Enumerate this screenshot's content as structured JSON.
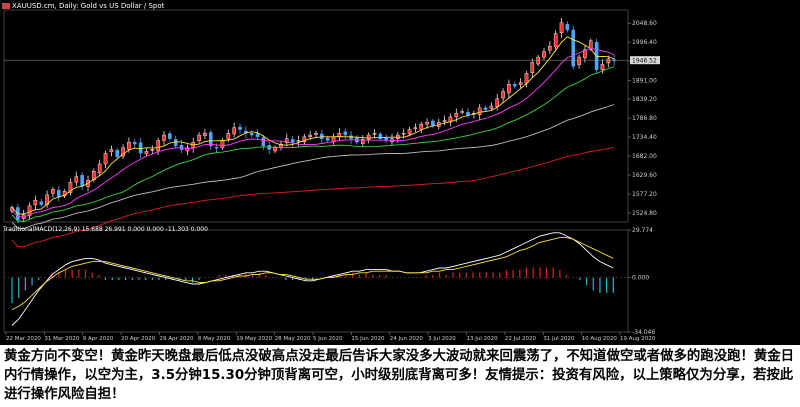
{
  "window": {
    "title": "XAUUSD.cm, Daily: Gold vs US Dollar / Spot",
    "indicator_title": "TraditionalMACD(12,26,9) 15.688 26.991 0.000 0.000 -11.303 0.000"
  },
  "chart_data": [
    {
      "type": "candlestick",
      "title": "XAUUSD.cm, Daily: Gold vs US Dollar / Spot",
      "symbol": "XAUUSD.cm",
      "timeframe": "Daily",
      "x_tick_labels": [
        "22 Mar 2020",
        "31 Mar 2020",
        "9 Apr 2020",
        "20 Apr 2020",
        "29 Apr 2020",
        "8 May 2020",
        "19 May 2020",
        "28 May 2020",
        "5 Jun 2020",
        "15 Jun 2020",
        "24 Jun 2020",
        "3 Jul 2020",
        "13 Jul 2020",
        "22 Jul 2020",
        "31 Jul 2020",
        "10 Aug 2020",
        "19 Aug 2020"
      ],
      "y_tick_labels": [
        "2048.60",
        "1996.40",
        "1944.20",
        "1891.00",
        "1839.20",
        "1786.80",
        "1734.40",
        "1682.00",
        "1629.60",
        "1577.20",
        "1524.80"
      ],
      "ylim": [
        1500,
        2085
      ],
      "current_price": "1946.52",
      "colors": {
        "up": "#ffffff",
        "down": "#4ea6ff",
        "up_body": "#ff2a2a",
        "ma1": "#ffe23a",
        "ma2": "#ff3cff",
        "ma3": "#38d838",
        "ma4": "#bcbcbc",
        "ma5": "#e02020"
      },
      "close": [
        1540,
        1505,
        1520,
        1545,
        1560,
        1548,
        1575,
        1590,
        1570,
        1585,
        1610,
        1625,
        1600,
        1615,
        1640,
        1660,
        1690,
        1700,
        1680,
        1705,
        1720,
        1715,
        1690,
        1695,
        1700,
        1725,
        1740,
        1730,
        1710,
        1700,
        1705,
        1720,
        1740,
        1745,
        1710,
        1705,
        1725,
        1745,
        1760,
        1755,
        1745,
        1740,
        1735,
        1710,
        1700,
        1705,
        1715,
        1730,
        1720,
        1725,
        1735,
        1740,
        1745,
        1730,
        1725,
        1735,
        1745,
        1740,
        1730,
        1720,
        1728,
        1740,
        1745,
        1730,
        1725,
        1730,
        1740,
        1745,
        1755,
        1760,
        1770,
        1775,
        1765,
        1775,
        1780,
        1790,
        1800,
        1805,
        1795,
        1800,
        1815,
        1810,
        1820,
        1840,
        1860,
        1880,
        1875,
        1885,
        1910,
        1940,
        1955,
        1970,
        1985,
        2020,
        2050,
        2030,
        1930,
        1955,
        1975,
        2000,
        1920,
        1935,
        1950,
        1946
      ]
    },
    {
      "type": "macd",
      "title": "TraditionalMACD(12,26,9) 15.688 26.991 0.000 0.000 -11.303 0.000",
      "y_tick_labels": [
        "29.774",
        "0.000",
        "-34.046"
      ],
      "ylim": [
        -34.046,
        29.774
      ],
      "colors": {
        "macd": "#ffffff",
        "signal": "#ffe23a",
        "hist_pos": "#e02020",
        "hist_neg": "#1fb8d8"
      },
      "macd": [
        -30,
        -26,
        -20,
        -14,
        -8,
        -3,
        2,
        5,
        8,
        10,
        11,
        12,
        12,
        11,
        9,
        8,
        7,
        6,
        5,
        4,
        3,
        2,
        1,
        0,
        -1,
        -2,
        -3,
        -4,
        -4,
        -3,
        -2,
        -1,
        0,
        1,
        2,
        3,
        3,
        4,
        4,
        3,
        2,
        1,
        0,
        -1,
        -2,
        -2,
        -1,
        0,
        1,
        2,
        3,
        4,
        4,
        5,
        5,
        5,
        5,
        4,
        4,
        3,
        3,
        3,
        4,
        5,
        6,
        6,
        7,
        8,
        9,
        10,
        11,
        12,
        13,
        14,
        16,
        18,
        20,
        22,
        24,
        26,
        27,
        28,
        28,
        26,
        24,
        21,
        17,
        13,
        10,
        8,
        6
      ],
      "signal": [
        -20,
        -18,
        -15,
        -11,
        -7,
        -3,
        0,
        3,
        5,
        7,
        8,
        9,
        10,
        10,
        10,
        9,
        8,
        7,
        6,
        5,
        4,
        3,
        2,
        1,
        0,
        -1,
        -2,
        -2,
        -3,
        -3,
        -2,
        -2,
        -1,
        0,
        1,
        1,
        2,
        2,
        3,
        3,
        2,
        2,
        1,
        0,
        -1,
        -1,
        -1,
        0,
        0,
        1,
        2,
        2,
        3,
        3,
        4,
        4,
        4,
        4,
        4,
        3,
        3,
        3,
        3,
        4,
        4,
        5,
        5,
        6,
        7,
        8,
        9,
        10,
        11,
        12,
        13,
        15,
        17,
        18,
        20,
        22,
        23,
        24,
        25,
        25,
        24,
        22,
        20,
        18,
        16,
        14,
        12
      ]
    }
  ],
  "caption": "黄金方向不变空！黄金昨天晚盘最后低点没破高点没走最后告诉大家没多大波动就来回震荡了，不知道做空或者做多的跑没跑！黄金日内行情操作，以空为主，3.5分钟15.30分钟顶背离可空，小时级别底背离可多！友情提示：投资有风险，以上策略仅为分享，若按此进行操作风险自担！"
}
